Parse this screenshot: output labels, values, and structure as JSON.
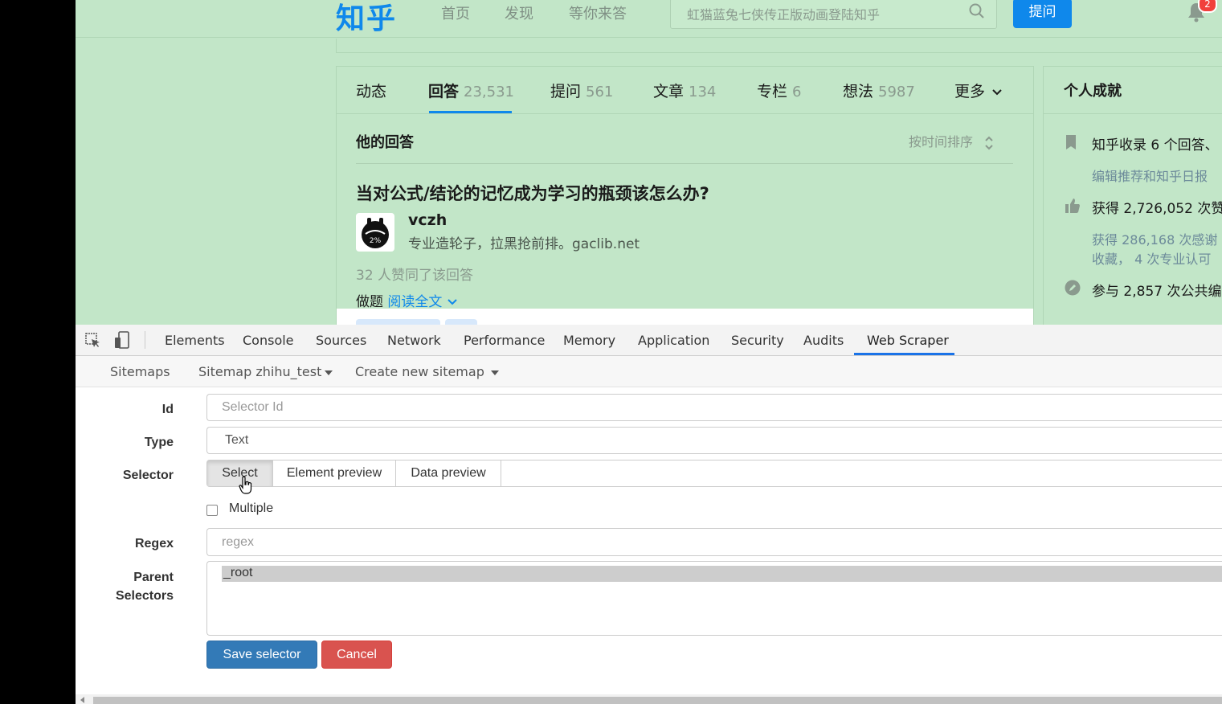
{
  "zhihu": {
    "logo": "知乎",
    "nav": [
      "首页",
      "发现",
      "等你来答"
    ],
    "search_placeholder": "虹猫蓝兔七侠传正版动画登陆知乎",
    "ask_button": "提问",
    "notification_count": "2",
    "tabs": [
      {
        "label": "动态",
        "count": ""
      },
      {
        "label": "回答",
        "count": "23,531"
      },
      {
        "label": "提问",
        "count": "561"
      },
      {
        "label": "文章",
        "count": "134"
      },
      {
        "label": "专栏",
        "count": "6"
      },
      {
        "label": "想法",
        "count": "5987"
      },
      {
        "label": "更多",
        "count": ""
      }
    ],
    "section_title": "他的回答",
    "sort_label": "按时间排序",
    "question": "当对公式/结论的记忆成为学习的瓶颈该怎么办?",
    "author_name": "vczh",
    "author_headline": "专业造轮子，拉黑抢前排。gaclib.net",
    "avatar_text": "2%",
    "votes": "32 人赞同了该回答",
    "excerpt": "做题",
    "read_more": "阅读全文",
    "sidebar": {
      "title": "个人成就",
      "lines": [
        "知乎收录 6 个回答、",
        "编辑推荐和知乎日报",
        "获得 2,726,052 次赞",
        "获得 286,168 次感谢",
        "收藏， 4 次专业认可",
        "参与 2,857 次公共编"
      ]
    }
  },
  "devtools": {
    "tabs": [
      "Elements",
      "Console",
      "Sources",
      "Network",
      "Performance",
      "Memory",
      "Application",
      "Security",
      "Audits",
      "Web Scraper"
    ],
    "active_tab": "Web Scraper",
    "scraper_nav": {
      "sitemaps": "Sitemaps",
      "current_sitemap": "Sitemap zhihu_test",
      "create": "Create new sitemap"
    },
    "form": {
      "id_label": "Id",
      "id_placeholder": "Selector Id",
      "type_label": "Type",
      "type_value": "Text",
      "selector_label": "Selector",
      "selector_buttons": [
        "Select",
        "Element preview",
        "Data preview"
      ],
      "multiple_label": "Multiple",
      "regex_label": "Regex",
      "regex_placeholder": "regex",
      "parent_label_1": "Parent",
      "parent_label_2": "Selectors",
      "parent_value": "_root",
      "save_button": "Save selector",
      "cancel_button": "Cancel"
    }
  },
  "colors": {
    "page_background": "#c2e6c8",
    "zhihu_blue": "#0f88eb",
    "devtools_accent": "#1a73e8",
    "save_blue": "#337ab7",
    "cancel_red": "#d9534f"
  }
}
